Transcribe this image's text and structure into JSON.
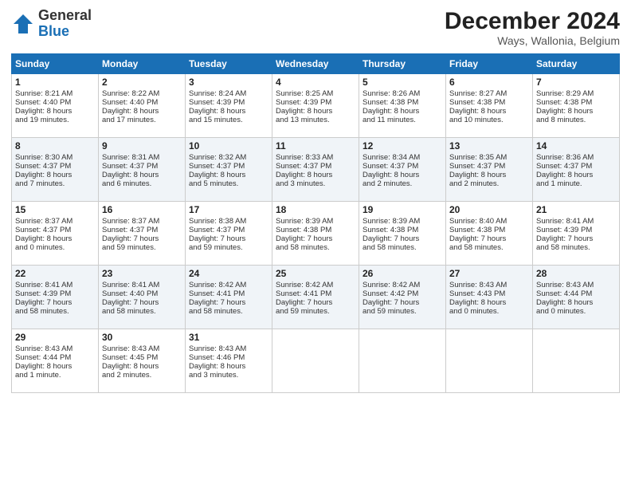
{
  "header": {
    "logo_general": "General",
    "logo_blue": "Blue",
    "month_title": "December 2024",
    "subtitle": "Ways, Wallonia, Belgium"
  },
  "days_of_week": [
    "Sunday",
    "Monday",
    "Tuesday",
    "Wednesday",
    "Thursday",
    "Friday",
    "Saturday"
  ],
  "weeks": [
    [
      {
        "day": "1",
        "lines": [
          "Sunrise: 8:21 AM",
          "Sunset: 4:40 PM",
          "Daylight: 8 hours",
          "and 19 minutes."
        ]
      },
      {
        "day": "2",
        "lines": [
          "Sunrise: 8:22 AM",
          "Sunset: 4:40 PM",
          "Daylight: 8 hours",
          "and 17 minutes."
        ]
      },
      {
        "day": "3",
        "lines": [
          "Sunrise: 8:24 AM",
          "Sunset: 4:39 PM",
          "Daylight: 8 hours",
          "and 15 minutes."
        ]
      },
      {
        "day": "4",
        "lines": [
          "Sunrise: 8:25 AM",
          "Sunset: 4:39 PM",
          "Daylight: 8 hours",
          "and 13 minutes."
        ]
      },
      {
        "day": "5",
        "lines": [
          "Sunrise: 8:26 AM",
          "Sunset: 4:38 PM",
          "Daylight: 8 hours",
          "and 11 minutes."
        ]
      },
      {
        "day": "6",
        "lines": [
          "Sunrise: 8:27 AM",
          "Sunset: 4:38 PM",
          "Daylight: 8 hours",
          "and 10 minutes."
        ]
      },
      {
        "day": "7",
        "lines": [
          "Sunrise: 8:29 AM",
          "Sunset: 4:38 PM",
          "Daylight: 8 hours",
          "and 8 minutes."
        ]
      }
    ],
    [
      {
        "day": "8",
        "lines": [
          "Sunrise: 8:30 AM",
          "Sunset: 4:37 PM",
          "Daylight: 8 hours",
          "and 7 minutes."
        ]
      },
      {
        "day": "9",
        "lines": [
          "Sunrise: 8:31 AM",
          "Sunset: 4:37 PM",
          "Daylight: 8 hours",
          "and 6 minutes."
        ]
      },
      {
        "day": "10",
        "lines": [
          "Sunrise: 8:32 AM",
          "Sunset: 4:37 PM",
          "Daylight: 8 hours",
          "and 5 minutes."
        ]
      },
      {
        "day": "11",
        "lines": [
          "Sunrise: 8:33 AM",
          "Sunset: 4:37 PM",
          "Daylight: 8 hours",
          "and 3 minutes."
        ]
      },
      {
        "day": "12",
        "lines": [
          "Sunrise: 8:34 AM",
          "Sunset: 4:37 PM",
          "Daylight: 8 hours",
          "and 2 minutes."
        ]
      },
      {
        "day": "13",
        "lines": [
          "Sunrise: 8:35 AM",
          "Sunset: 4:37 PM",
          "Daylight: 8 hours",
          "and 2 minutes."
        ]
      },
      {
        "day": "14",
        "lines": [
          "Sunrise: 8:36 AM",
          "Sunset: 4:37 PM",
          "Daylight: 8 hours",
          "and 1 minute."
        ]
      }
    ],
    [
      {
        "day": "15",
        "lines": [
          "Sunrise: 8:37 AM",
          "Sunset: 4:37 PM",
          "Daylight: 8 hours",
          "and 0 minutes."
        ]
      },
      {
        "day": "16",
        "lines": [
          "Sunrise: 8:37 AM",
          "Sunset: 4:37 PM",
          "Daylight: 7 hours",
          "and 59 minutes."
        ]
      },
      {
        "day": "17",
        "lines": [
          "Sunrise: 8:38 AM",
          "Sunset: 4:37 PM",
          "Daylight: 7 hours",
          "and 59 minutes."
        ]
      },
      {
        "day": "18",
        "lines": [
          "Sunrise: 8:39 AM",
          "Sunset: 4:38 PM",
          "Daylight: 7 hours",
          "and 58 minutes."
        ]
      },
      {
        "day": "19",
        "lines": [
          "Sunrise: 8:39 AM",
          "Sunset: 4:38 PM",
          "Daylight: 7 hours",
          "and 58 minutes."
        ]
      },
      {
        "day": "20",
        "lines": [
          "Sunrise: 8:40 AM",
          "Sunset: 4:38 PM",
          "Daylight: 7 hours",
          "and 58 minutes."
        ]
      },
      {
        "day": "21",
        "lines": [
          "Sunrise: 8:41 AM",
          "Sunset: 4:39 PM",
          "Daylight: 7 hours",
          "and 58 minutes."
        ]
      }
    ],
    [
      {
        "day": "22",
        "lines": [
          "Sunrise: 8:41 AM",
          "Sunset: 4:39 PM",
          "Daylight: 7 hours",
          "and 58 minutes."
        ]
      },
      {
        "day": "23",
        "lines": [
          "Sunrise: 8:41 AM",
          "Sunset: 4:40 PM",
          "Daylight: 7 hours",
          "and 58 minutes."
        ]
      },
      {
        "day": "24",
        "lines": [
          "Sunrise: 8:42 AM",
          "Sunset: 4:41 PM",
          "Daylight: 7 hours",
          "and 58 minutes."
        ]
      },
      {
        "day": "25",
        "lines": [
          "Sunrise: 8:42 AM",
          "Sunset: 4:41 PM",
          "Daylight: 7 hours",
          "and 59 minutes."
        ]
      },
      {
        "day": "26",
        "lines": [
          "Sunrise: 8:42 AM",
          "Sunset: 4:42 PM",
          "Daylight: 7 hours",
          "and 59 minutes."
        ]
      },
      {
        "day": "27",
        "lines": [
          "Sunrise: 8:43 AM",
          "Sunset: 4:43 PM",
          "Daylight: 8 hours",
          "and 0 minutes."
        ]
      },
      {
        "day": "28",
        "lines": [
          "Sunrise: 8:43 AM",
          "Sunset: 4:44 PM",
          "Daylight: 8 hours",
          "and 0 minutes."
        ]
      }
    ],
    [
      {
        "day": "29",
        "lines": [
          "Sunrise: 8:43 AM",
          "Sunset: 4:44 PM",
          "Daylight: 8 hours",
          "and 1 minute."
        ]
      },
      {
        "day": "30",
        "lines": [
          "Sunrise: 8:43 AM",
          "Sunset: 4:45 PM",
          "Daylight: 8 hours",
          "and 2 minutes."
        ]
      },
      {
        "day": "31",
        "lines": [
          "Sunrise: 8:43 AM",
          "Sunset: 4:46 PM",
          "Daylight: 8 hours",
          "and 3 minutes."
        ]
      },
      null,
      null,
      null,
      null
    ]
  ]
}
